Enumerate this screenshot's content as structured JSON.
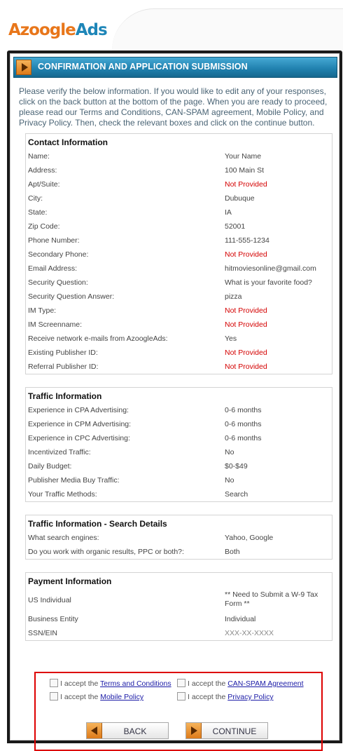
{
  "logo": {
    "part1": "Azoogle",
    "part2": "Ads"
  },
  "title": "CONFIRMATION AND APPLICATION SUBMISSION",
  "intro": "Please verify the below information. If you would like to edit any of your responses, click on the back button at the bottom of the page. When you are ready to proceed, please read our Terms and Conditions, CAN-SPAM agreement, Mobile Policy, and Privacy Policy. Then, check the relevant boxes and click on the continue button.",
  "contact": {
    "heading": "Contact Information",
    "rows": [
      {
        "label": "Name:",
        "value": "Your Name",
        "missing": false
      },
      {
        "label": "Address:",
        "value": "100 Main St",
        "missing": false
      },
      {
        "label": "Apt/Suite:",
        "value": "Not Provided",
        "missing": true
      },
      {
        "label": "City:",
        "value": "Dubuque",
        "missing": false
      },
      {
        "label": "State:",
        "value": "IA",
        "missing": false
      },
      {
        "label": "Zip Code:",
        "value": "52001",
        "missing": false
      },
      {
        "label": "Phone Number:",
        "value": "111-555-1234",
        "missing": false
      },
      {
        "label": "Secondary Phone:",
        "value": "Not Provided",
        "missing": true
      },
      {
        "label": "Email Address:",
        "value": "hitmoviesonline@gmail.com",
        "missing": false
      },
      {
        "label": "Security Question:",
        "value": "What is your favorite food?",
        "missing": false
      },
      {
        "label": "Security Question Answer:",
        "value": "pizza",
        "missing": false
      },
      {
        "label": "IM Type:",
        "value": "Not Provided",
        "missing": true
      },
      {
        "label": "IM Screenname:",
        "value": "Not Provided",
        "missing": true
      },
      {
        "label": "Receive network e-mails from AzoogleAds:",
        "value": "Yes",
        "missing": false
      },
      {
        "label": "Existing Publisher ID:",
        "value": "Not Provided",
        "missing": true
      },
      {
        "label": "Referral Publisher ID:",
        "value": "Not Provided",
        "missing": true
      }
    ]
  },
  "traffic": {
    "heading": "Traffic Information",
    "rows": [
      {
        "label": "Experience in CPA Advertising:",
        "value": "0-6 months"
      },
      {
        "label": "Experience in CPM Advertising:",
        "value": "0-6 months"
      },
      {
        "label": "Experience in CPC Advertising:",
        "value": "0-6 months"
      },
      {
        "label": "Incentivized Traffic:",
        "value": "No"
      },
      {
        "label": "Daily Budget:",
        "value": "$0-$49"
      },
      {
        "label": "Publisher Media Buy Traffic:",
        "value": "No"
      },
      {
        "label": "Your Traffic Methods:",
        "value": "Search"
      }
    ]
  },
  "search": {
    "heading": "Traffic Information - Search Details",
    "rows": [
      {
        "label": "What search engines:",
        "value": "Yahoo, Google"
      },
      {
        "label": "Do you work with organic results, PPC or both?:",
        "value": "Both"
      }
    ]
  },
  "payment": {
    "heading": "Payment Information",
    "rows": [
      {
        "label": "US Individual",
        "value": "** Need to Submit a W-9 Tax Form **"
      },
      {
        "label": "Business Entity",
        "value": "Individual"
      },
      {
        "label": "SSN/EIN",
        "value": "XXX-XX-XXXX"
      }
    ]
  },
  "agreements": {
    "prefix": "I accept the",
    "terms": "Terms and Conditions",
    "canspam": "CAN-SPAM Agreement",
    "mobile": "Mobile Policy",
    "privacy": "Privacy Policy"
  },
  "buttons": {
    "back": "BACK",
    "continue": "CONTINUE"
  },
  "colors": {
    "missing": "#d40000",
    "accent": "#1f7fad",
    "highlight": "#dd0000"
  }
}
